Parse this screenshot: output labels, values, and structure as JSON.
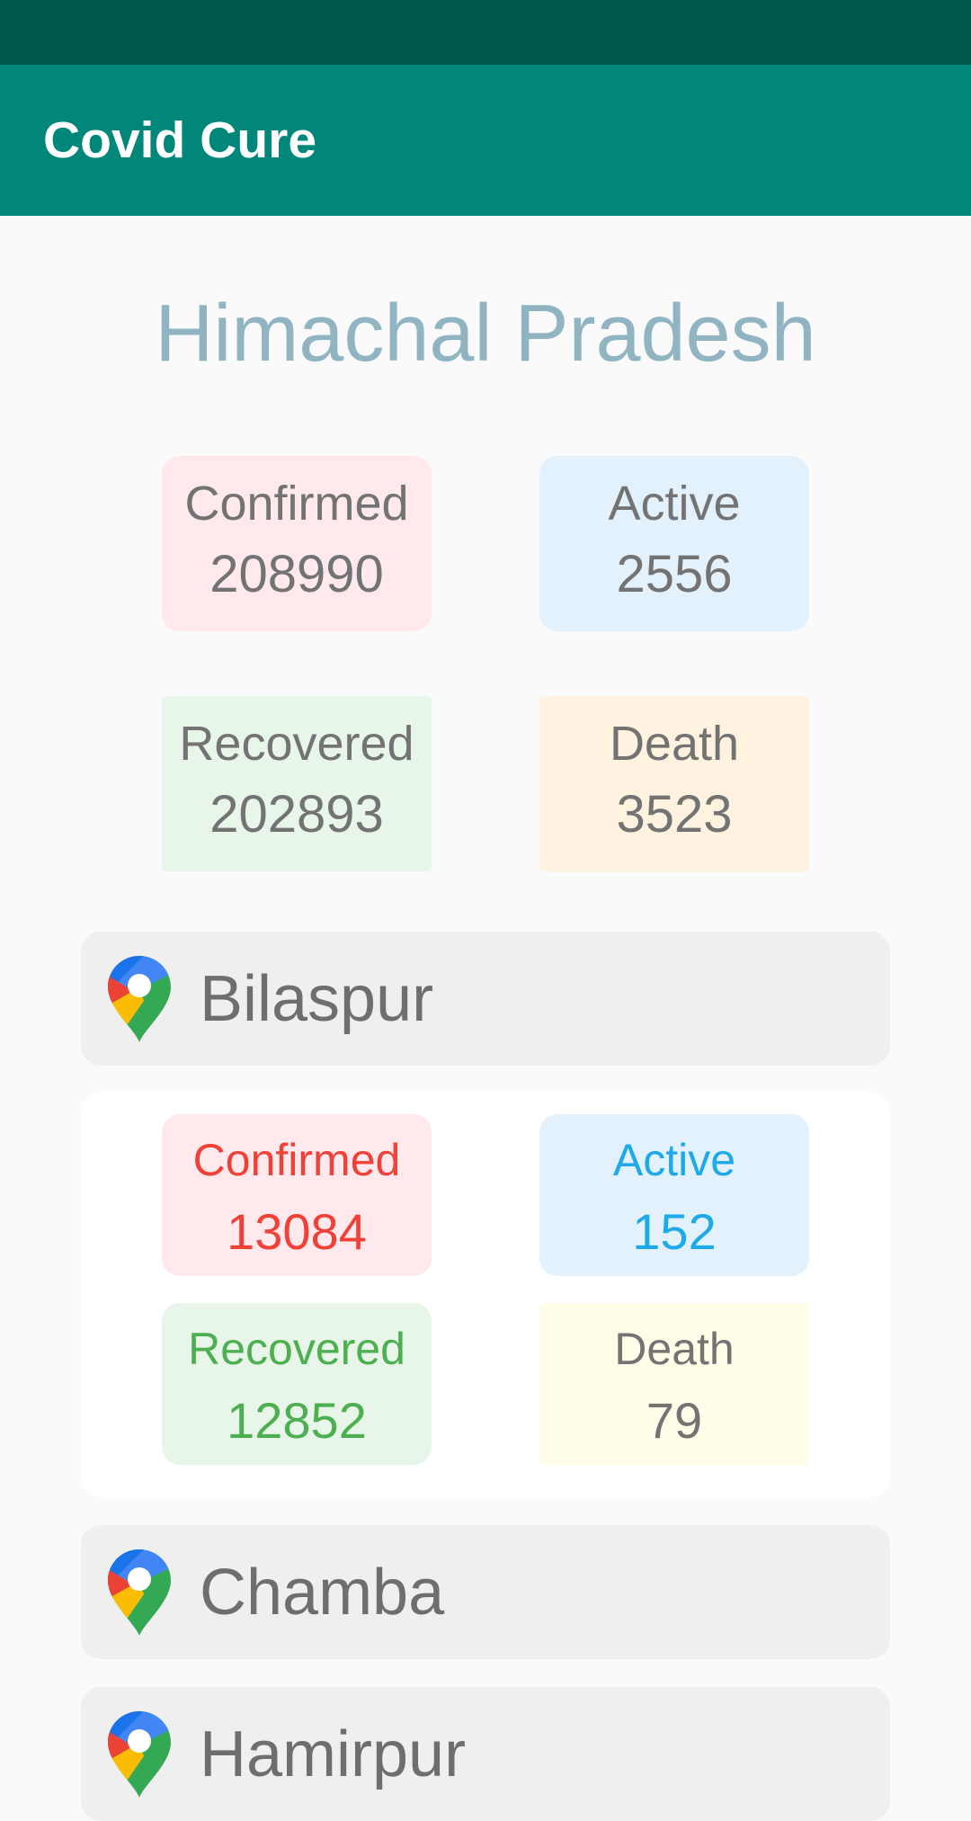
{
  "app": {
    "title": "Covid Cure"
  },
  "state": {
    "name": "Himachal Pradesh",
    "stats": {
      "confirmed": {
        "label": "Confirmed",
        "value": "208990"
      },
      "active": {
        "label": "Active",
        "value": "2556"
      },
      "recovered": {
        "label": "Recovered",
        "value": "202893"
      },
      "death": {
        "label": "Death",
        "value": "3523"
      }
    }
  },
  "districts": [
    {
      "name": "Bilaspur",
      "stats": {
        "confirmed": {
          "label": "Confirmed",
          "value": "13084"
        },
        "active": {
          "label": "Active",
          "value": "152"
        },
        "recovered": {
          "label": "Recovered",
          "value": "12852"
        },
        "death": {
          "label": "Death",
          "value": "79"
        }
      }
    },
    {
      "name": "Chamba"
    },
    {
      "name": "Hamirpur"
    }
  ],
  "icons": {
    "district_pin": "map-pin-icon"
  },
  "colors": {
    "status_bar": "#00574b",
    "app_bar": "#00877a",
    "state_title": "#90b4c2",
    "confirmed_text": "#ef4138",
    "active_text": "#1ea9e9",
    "recovered_text": "#4caf50"
  }
}
